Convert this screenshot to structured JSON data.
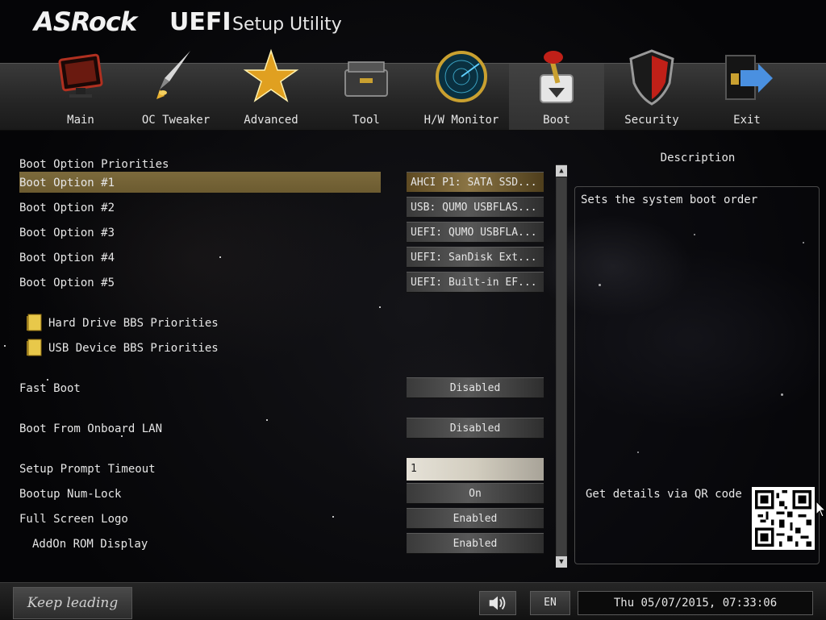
{
  "header": {
    "brand": "ASRock",
    "uefi": "UEFI",
    "subtitle": "Setup Utility"
  },
  "nav": {
    "active_tab": "Boot",
    "tabs": [
      {
        "label": "Main",
        "icon": "monitor-icon"
      },
      {
        "label": "OC Tweaker",
        "icon": "rocket-icon"
      },
      {
        "label": "Advanced",
        "icon": "star-icon"
      },
      {
        "label": "Tool",
        "icon": "toolbox-icon"
      },
      {
        "label": "H/W Monitor",
        "icon": "radar-icon"
      },
      {
        "label": "Boot",
        "icon": "boot-lever-icon"
      },
      {
        "label": "Security",
        "icon": "shield-icon"
      },
      {
        "label": "Exit",
        "icon": "exit-door-icon"
      }
    ]
  },
  "boot": {
    "section_title": "Boot Option Priorities",
    "options": [
      {
        "label": "Boot Option #1",
        "value": "AHCI P1: SATA SSD..."
      },
      {
        "label": "Boot Option #2",
        "value": "USB: QUMO USBFLAS..."
      },
      {
        "label": "Boot Option #3",
        "value": "UEFI: QUMO USBFLA..."
      },
      {
        "label": "Boot Option #4",
        "value": "UEFI: SanDisk Ext..."
      },
      {
        "label": "Boot Option #5",
        "value": "UEFI: Built-in EF..."
      }
    ],
    "submenus": [
      {
        "label": "Hard Drive BBS Priorities"
      },
      {
        "label": "USB Device BBS Priorities"
      }
    ],
    "fast_boot": {
      "label": "Fast Boot",
      "value": "Disabled"
    },
    "onboard_lan": {
      "label": "Boot From Onboard LAN",
      "value": "Disabled"
    },
    "prompt_timeout": {
      "label": "Setup Prompt Timeout",
      "value": "1"
    },
    "numlock": {
      "label": "Bootup Num-Lock",
      "value": "On"
    },
    "fullscreen_logo": {
      "label": "Full Screen Logo",
      "value": "Enabled"
    },
    "addon_rom": {
      "label": "AddOn ROM Display",
      "value": "Enabled"
    }
  },
  "description": {
    "title": "Description",
    "text": "Sets the system boot order",
    "qr_label": "Get details via QR code"
  },
  "footer": {
    "slogan": "Keep leading",
    "language": "EN",
    "datetime": "Thu 05/07/2015, 07:33:06"
  },
  "colors": {
    "highlight": "#75643a",
    "panel_border": "#4a4a4a",
    "nav_bg": "#2c2c2c"
  }
}
